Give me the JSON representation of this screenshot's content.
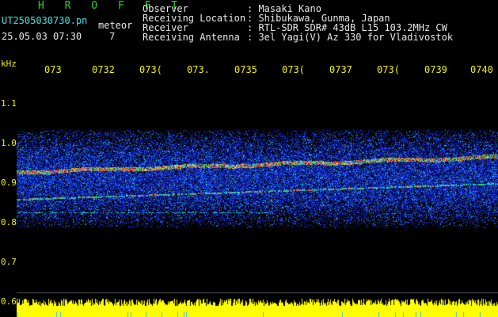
{
  "header": {
    "title_letters": "H R O F F T",
    "filename": "UT2505030730.pn",
    "meteor_label": "meteor",
    "date_time": "25.05.03 07:30",
    "meteor_count": "7",
    "fields": [
      {
        "label": "Observer",
        "value": ": Masaki Kano"
      },
      {
        "label": "Receiving Location",
        "value": ": Shibukawa, Gunma, Japan"
      },
      {
        "label": "Receiver",
        "value": ": RTL-SDR SDR# 43dB L15 103.2MHz CW"
      },
      {
        "label": "Receiving Antenna",
        "value": ": 3el Yagi(V) Az 330 for Vladivostok"
      }
    ]
  },
  "spectrogram": {
    "y_unit": "kHz",
    "y_ticks": [
      "1.1",
      "1.0",
      "0.9",
      "0.8",
      "0.7",
      "0.6"
    ],
    "x_ticks": [
      "073",
      "0732",
      "073(",
      "073.",
      "0735",
      "073(",
      "0737",
      "073(",
      "0739",
      "0740"
    ],
    "colors": {
      "background": "#000000",
      "axis_text": "#f0f000",
      "noise": "#1a3cff",
      "signal": "#ff2020",
      "amplitude_bar": "#ffff00"
    }
  }
}
